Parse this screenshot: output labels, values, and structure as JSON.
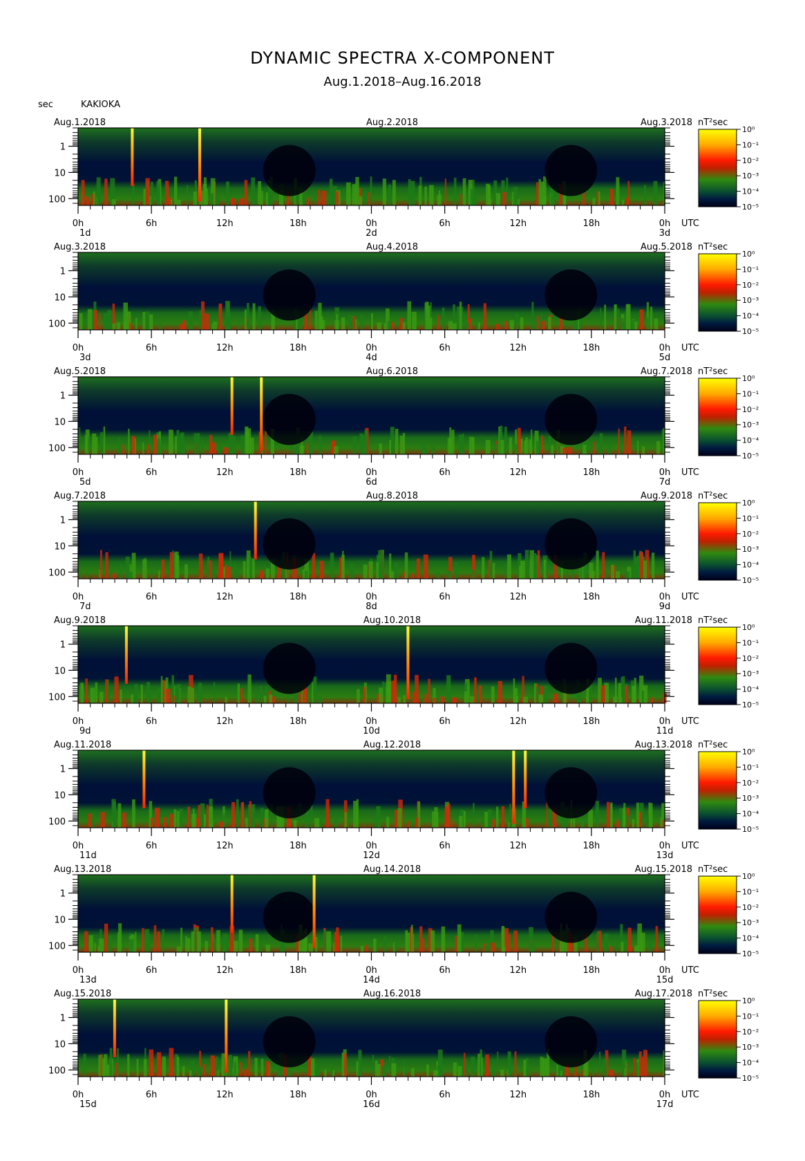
{
  "header": {
    "title": "DYNAMIC SPECTRA X-COMPONENT",
    "subtitle": "Aug.1.2018–Aug.16.2018",
    "unit_left": "sec",
    "station": "KAKIOKA"
  },
  "chart_data": {
    "type": "heatmap",
    "yaxis": {
      "label": "sec",
      "scale": "log",
      "ticks": [
        "1",
        "10",
        "100"
      ]
    },
    "xaxis": {
      "ticks": [
        "0h",
        "6h",
        "12h",
        "18h",
        "0h",
        "6h",
        "12h",
        "18h",
        "0h"
      ],
      "unit": "UTC"
    },
    "colorbar": {
      "unit": "nT²sec",
      "ticks": [
        "10⁰",
        "10⁻¹",
        "10⁻²",
        "10⁻³",
        "10⁻⁴",
        "10⁻⁵"
      ]
    },
    "panels": [
      {
        "left_date": "Aug.1.2018",
        "mid_date": "Aug.2.2018",
        "right_date": "Aug.3.2018",
        "day_labels": [
          "1d",
          "2d",
          "3d"
        ]
      },
      {
        "left_date": "Aug.3.2018",
        "mid_date": "Aug.4.2018",
        "right_date": "Aug.5.2018",
        "day_labels": [
          "3d",
          "4d",
          "5d"
        ]
      },
      {
        "left_date": "Aug.5.2018",
        "mid_date": "Aug.6.2018",
        "right_date": "Aug.7.2018",
        "day_labels": [
          "5d",
          "6d",
          "7d"
        ]
      },
      {
        "left_date": "Aug.7.2018",
        "mid_date": "Aug.8.2018",
        "right_date": "Aug.9.2018",
        "day_labels": [
          "7d",
          "8d",
          "9d"
        ]
      },
      {
        "left_date": "Aug.9.2018",
        "mid_date": "Aug.10.2018",
        "right_date": "Aug.11.2018",
        "day_labels": [
          "9d",
          "10d",
          "11d"
        ]
      },
      {
        "left_date": "Aug.11.2018",
        "mid_date": "Aug.12.2018",
        "right_date": "Aug.13.2018",
        "day_labels": [
          "11d",
          "12d",
          "13d"
        ]
      },
      {
        "left_date": "Aug.13.2018",
        "mid_date": "Aug.14.2018",
        "right_date": "Aug.15.2018",
        "day_labels": [
          "13d",
          "14d",
          "15d"
        ]
      },
      {
        "left_date": "Aug.15.2018",
        "mid_date": "Aug.16.2018",
        "right_date": "Aug.17.2018",
        "day_labels": [
          "15d",
          "16d",
          "17d"
        ]
      }
    ],
    "colors": {
      "high": "#ffff00",
      "mid": "#ff2200",
      "low_mid": "#1f8a10",
      "low": "#001040",
      "floor": "#000000"
    }
  }
}
